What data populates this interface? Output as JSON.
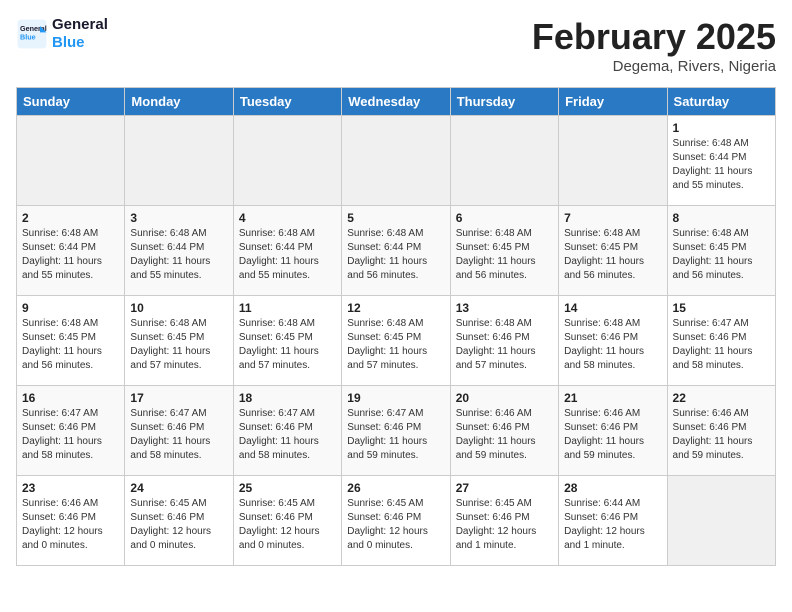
{
  "header": {
    "logo_line1": "General",
    "logo_line2": "Blue",
    "month_title": "February 2025",
    "location": "Degema, Rivers, Nigeria"
  },
  "days_of_week": [
    "Sunday",
    "Monday",
    "Tuesday",
    "Wednesday",
    "Thursday",
    "Friday",
    "Saturday"
  ],
  "weeks": [
    [
      {
        "day": "",
        "info": ""
      },
      {
        "day": "",
        "info": ""
      },
      {
        "day": "",
        "info": ""
      },
      {
        "day": "",
        "info": ""
      },
      {
        "day": "",
        "info": ""
      },
      {
        "day": "",
        "info": ""
      },
      {
        "day": "1",
        "info": "Sunrise: 6:48 AM\nSunset: 6:44 PM\nDaylight: 11 hours and 55 minutes."
      }
    ],
    [
      {
        "day": "2",
        "info": "Sunrise: 6:48 AM\nSunset: 6:44 PM\nDaylight: 11 hours and 55 minutes."
      },
      {
        "day": "3",
        "info": "Sunrise: 6:48 AM\nSunset: 6:44 PM\nDaylight: 11 hours and 55 minutes."
      },
      {
        "day": "4",
        "info": "Sunrise: 6:48 AM\nSunset: 6:44 PM\nDaylight: 11 hours and 55 minutes."
      },
      {
        "day": "5",
        "info": "Sunrise: 6:48 AM\nSunset: 6:44 PM\nDaylight: 11 hours and 56 minutes."
      },
      {
        "day": "6",
        "info": "Sunrise: 6:48 AM\nSunset: 6:45 PM\nDaylight: 11 hours and 56 minutes."
      },
      {
        "day": "7",
        "info": "Sunrise: 6:48 AM\nSunset: 6:45 PM\nDaylight: 11 hours and 56 minutes."
      },
      {
        "day": "8",
        "info": "Sunrise: 6:48 AM\nSunset: 6:45 PM\nDaylight: 11 hours and 56 minutes."
      }
    ],
    [
      {
        "day": "9",
        "info": "Sunrise: 6:48 AM\nSunset: 6:45 PM\nDaylight: 11 hours and 56 minutes."
      },
      {
        "day": "10",
        "info": "Sunrise: 6:48 AM\nSunset: 6:45 PM\nDaylight: 11 hours and 57 minutes."
      },
      {
        "day": "11",
        "info": "Sunrise: 6:48 AM\nSunset: 6:45 PM\nDaylight: 11 hours and 57 minutes."
      },
      {
        "day": "12",
        "info": "Sunrise: 6:48 AM\nSunset: 6:45 PM\nDaylight: 11 hours and 57 minutes."
      },
      {
        "day": "13",
        "info": "Sunrise: 6:48 AM\nSunset: 6:46 PM\nDaylight: 11 hours and 57 minutes."
      },
      {
        "day": "14",
        "info": "Sunrise: 6:48 AM\nSunset: 6:46 PM\nDaylight: 11 hours and 58 minutes."
      },
      {
        "day": "15",
        "info": "Sunrise: 6:47 AM\nSunset: 6:46 PM\nDaylight: 11 hours and 58 minutes."
      }
    ],
    [
      {
        "day": "16",
        "info": "Sunrise: 6:47 AM\nSunset: 6:46 PM\nDaylight: 11 hours and 58 minutes."
      },
      {
        "day": "17",
        "info": "Sunrise: 6:47 AM\nSunset: 6:46 PM\nDaylight: 11 hours and 58 minutes."
      },
      {
        "day": "18",
        "info": "Sunrise: 6:47 AM\nSunset: 6:46 PM\nDaylight: 11 hours and 58 minutes."
      },
      {
        "day": "19",
        "info": "Sunrise: 6:47 AM\nSunset: 6:46 PM\nDaylight: 11 hours and 59 minutes."
      },
      {
        "day": "20",
        "info": "Sunrise: 6:46 AM\nSunset: 6:46 PM\nDaylight: 11 hours and 59 minutes."
      },
      {
        "day": "21",
        "info": "Sunrise: 6:46 AM\nSunset: 6:46 PM\nDaylight: 11 hours and 59 minutes."
      },
      {
        "day": "22",
        "info": "Sunrise: 6:46 AM\nSunset: 6:46 PM\nDaylight: 11 hours and 59 minutes."
      }
    ],
    [
      {
        "day": "23",
        "info": "Sunrise: 6:46 AM\nSunset: 6:46 PM\nDaylight: 12 hours and 0 minutes."
      },
      {
        "day": "24",
        "info": "Sunrise: 6:45 AM\nSunset: 6:46 PM\nDaylight: 12 hours and 0 minutes."
      },
      {
        "day": "25",
        "info": "Sunrise: 6:45 AM\nSunset: 6:46 PM\nDaylight: 12 hours and 0 minutes."
      },
      {
        "day": "26",
        "info": "Sunrise: 6:45 AM\nSunset: 6:46 PM\nDaylight: 12 hours and 0 minutes."
      },
      {
        "day": "27",
        "info": "Sunrise: 6:45 AM\nSunset: 6:46 PM\nDaylight: 12 hours and 1 minute."
      },
      {
        "day": "28",
        "info": "Sunrise: 6:44 AM\nSunset: 6:46 PM\nDaylight: 12 hours and 1 minute."
      },
      {
        "day": "",
        "info": ""
      }
    ]
  ]
}
